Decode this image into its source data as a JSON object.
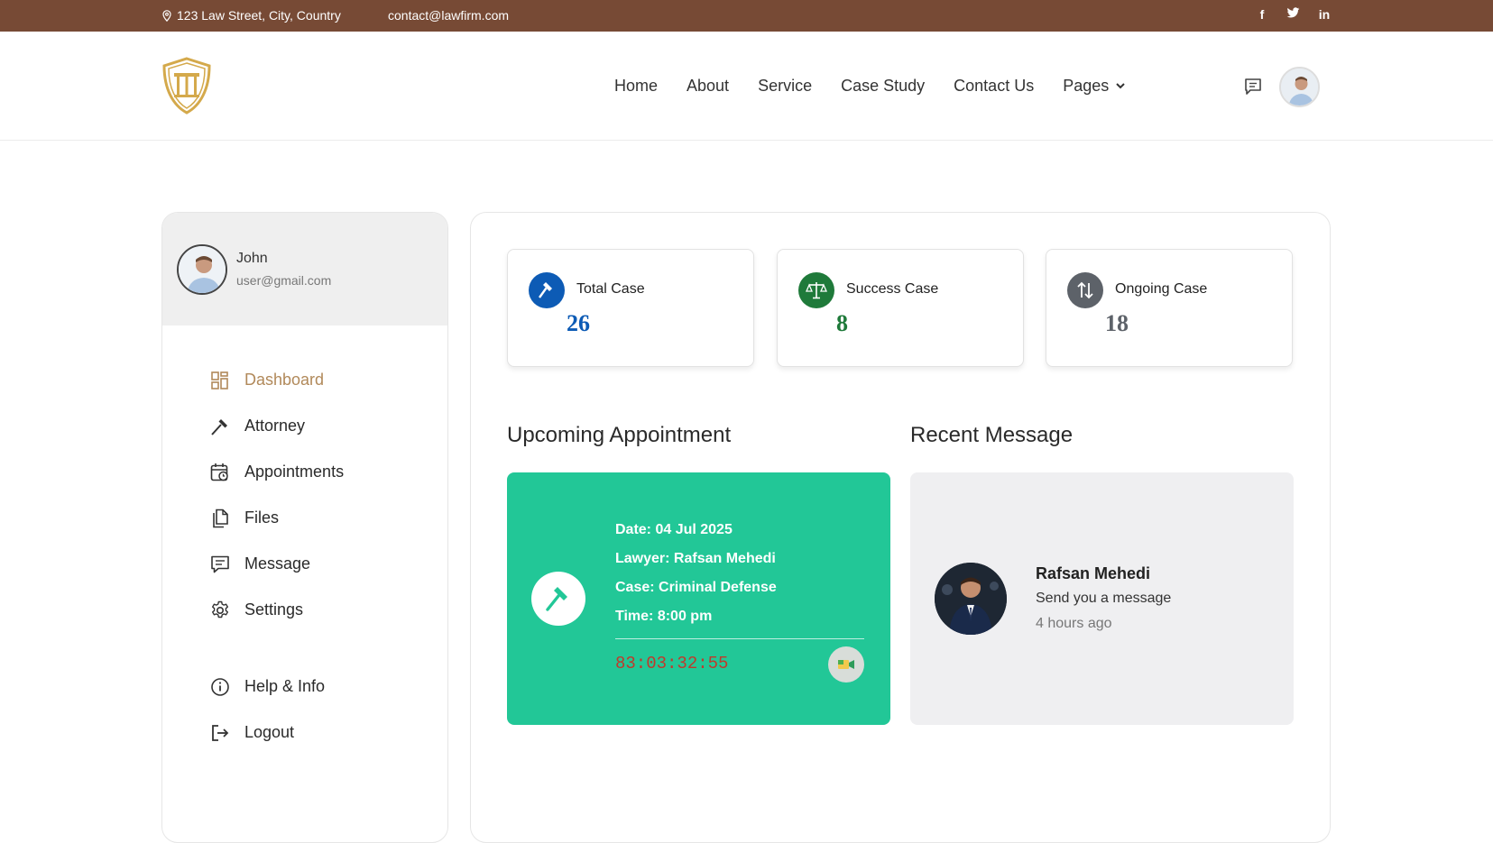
{
  "topbar": {
    "address": "123 Law Street, City, Country",
    "email": "contact@lawfirm.com",
    "social": [
      {
        "icon": "facebook-icon",
        "label": "f"
      },
      {
        "icon": "twitter-icon",
        "label": "🐦"
      },
      {
        "icon": "linkedin-icon",
        "label": "in"
      }
    ]
  },
  "nav": {
    "items": [
      "Home",
      "About",
      "Service",
      "Case Study",
      "Contact Us",
      "Pages"
    ]
  },
  "sidebar": {
    "user_name": "John",
    "user_email": "user@gmail.com",
    "menu": [
      {
        "label": "Dashboard",
        "icon": "dashboard-icon",
        "active": true
      },
      {
        "label": "Attorney",
        "icon": "hammer-icon"
      },
      {
        "label": "Appointments",
        "icon": "calendar-clock-icon"
      },
      {
        "label": "Files",
        "icon": "files-icon"
      },
      {
        "label": "Message",
        "icon": "message-icon"
      },
      {
        "label": "Settings",
        "icon": "gear-icon"
      }
    ],
    "bottom_menu": [
      {
        "label": "Help & Info",
        "icon": "info-icon"
      },
      {
        "label": "Logout",
        "icon": "logout-icon"
      }
    ]
  },
  "stats": [
    {
      "label": "Total Case",
      "value": "26",
      "color": "#0d5bb5"
    },
    {
      "label": "Success Case",
      "value": "8",
      "color": "#1f7a3a"
    },
    {
      "label": "Ongoing Case",
      "value": "18",
      "color": "#5d6269"
    }
  ],
  "appointment": {
    "title": "Upcoming Appointment",
    "date": "Date: 04 Jul 2025",
    "lawyer": "Lawyer: Rafsan Mehedi",
    "case": "Case: Criminal Defense",
    "time": "Time: 8:00 pm",
    "countdown": "83:03:32:55",
    "accent": "#22c797"
  },
  "recent_message": {
    "title": "Recent Message",
    "name": "Rafsan Mehedi",
    "text": "Send you a message",
    "ago": "4 hours ago"
  },
  "colors": {
    "topbar": "#774a35",
    "active_menu": "#b1895a"
  }
}
